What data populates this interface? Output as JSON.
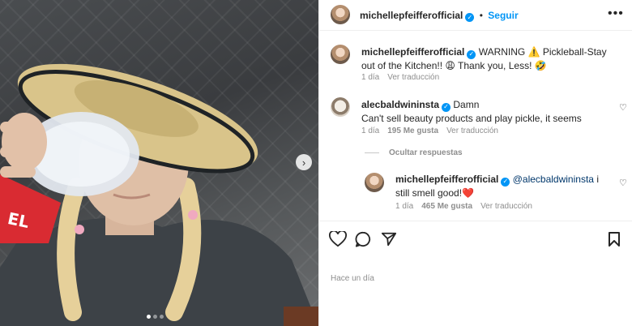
{
  "post": {
    "author": "michellepfeifferofficial",
    "follow_label": "Seguir",
    "separator": "•",
    "more_label": "•••"
  },
  "caption": {
    "username": "michellepfeifferofficial",
    "text": "WARNING ⚠️ Pickleball-Stay out of the Kitchen!! 😩 Thank you, Less! 🤣",
    "time": "1 día",
    "translate": "Ver traducción"
  },
  "comments": [
    {
      "username": "alecbaldwininsta",
      "first_line": "Damn",
      "second_line": "Can't sell beauty products and play pickle, it seems",
      "time": "1 día",
      "likes": "195 Me gusta",
      "translate": "Ver traducción"
    }
  ],
  "hide_replies": "Ocultar respuestas",
  "reply": {
    "username": "michellepfeifferofficial",
    "mention": "@alecbaldwininsta",
    "text": "i still smell good!❤️",
    "time": "1 día",
    "likes": "465 Me gusta",
    "translate": "Ver traducción"
  },
  "footer": {
    "date": "Hace un día"
  },
  "media": {
    "next": "›",
    "dots": 3,
    "active_dot": 0
  },
  "colors": {
    "accent": "#0095f6",
    "verified": "#0095f6"
  }
}
